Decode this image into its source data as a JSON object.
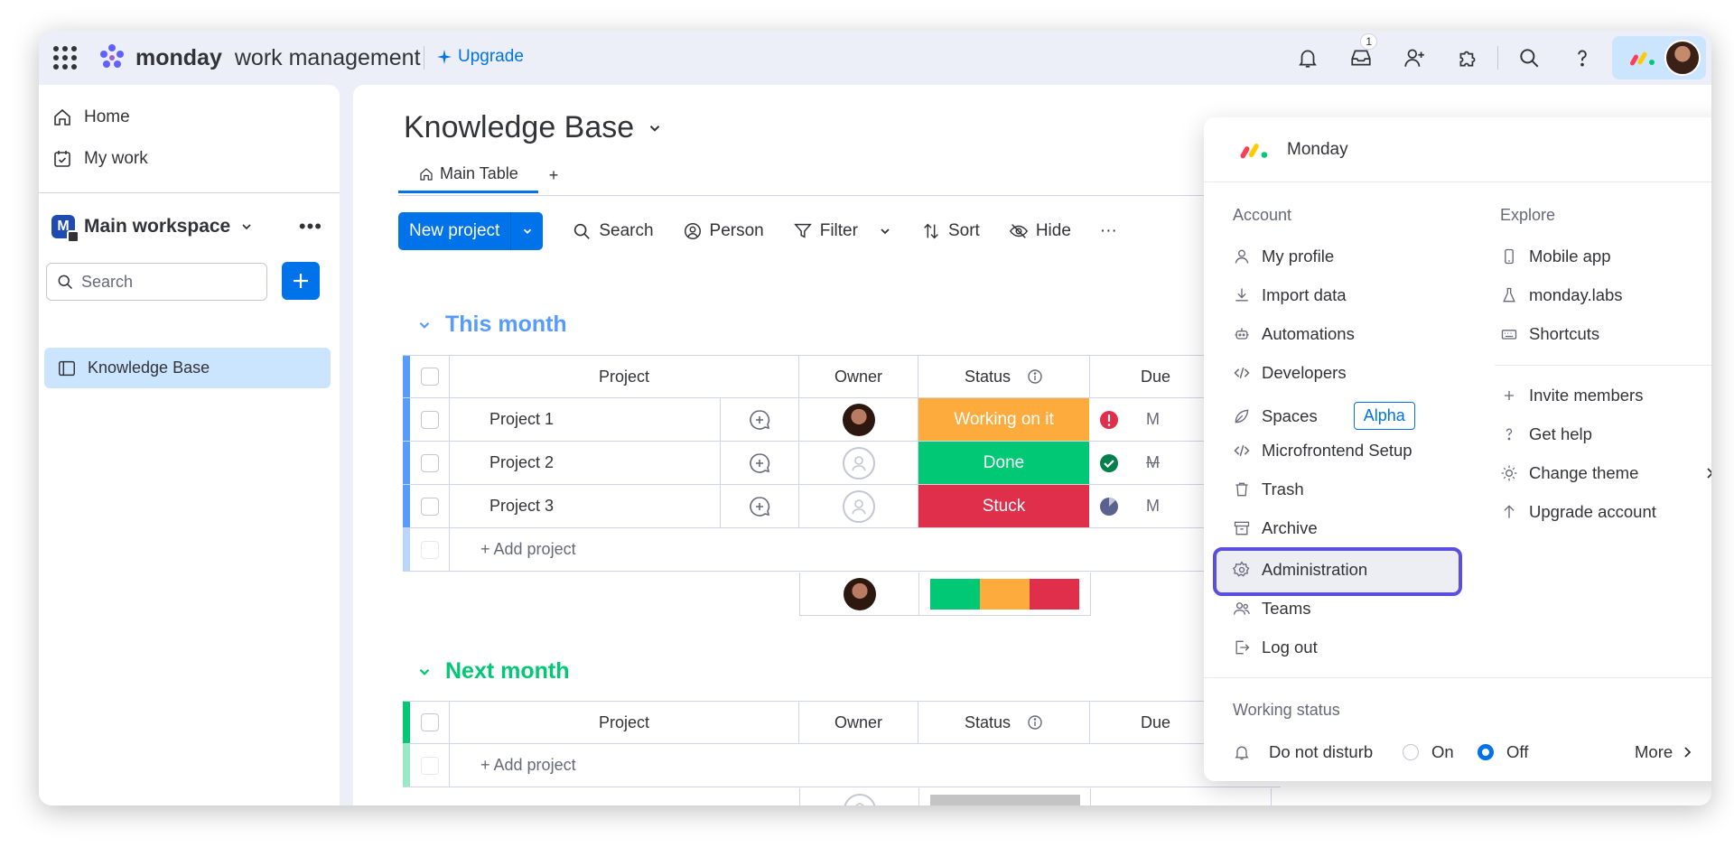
{
  "topbar": {
    "brand_bold": "monday",
    "brand_rest": "work management",
    "upgrade_label": "Upgrade",
    "inbox_count": "1"
  },
  "sidebar": {
    "home": "Home",
    "my_work": "My work",
    "workspace_initial": "M",
    "workspace_name": "Main workspace",
    "search_placeholder": "Search",
    "board": "Knowledge Base"
  },
  "board": {
    "title": "Knowledge Base",
    "tab_main": "Main Table",
    "tab_add": "+",
    "toolbar": {
      "new_project": "New project",
      "search": "Search",
      "person": "Person",
      "filter": "Filter",
      "sort": "Sort",
      "hide": "Hide",
      "more": "···"
    },
    "columns": {
      "project": "Project",
      "owner": "Owner",
      "status": "Status",
      "due": "Due"
    },
    "groups": [
      {
        "name": "This month",
        "color": "#579bfc",
        "rows": [
          {
            "name": "Project 1",
            "status": "Working on it",
            "status_color": "#fdab3d",
            "due": "M"
          },
          {
            "name": "Project 2",
            "status": "Done",
            "status_color": "#00c875",
            "due": "M"
          },
          {
            "name": "Project 3",
            "status": "Stuck",
            "status_color": "#df2f4a",
            "due": "M"
          }
        ],
        "add_label": "+ Add project"
      },
      {
        "name": "Next month",
        "color": "#00c875",
        "add_label": "+ Add project"
      }
    ]
  },
  "menu": {
    "account_name": "Monday",
    "account_title": "Account",
    "explore_title": "Explore",
    "account_items": [
      "My profile",
      "Import data",
      "Automations",
      "Developers",
      "Spaces",
      "Microfrontend Setup",
      "Trash",
      "Archive",
      "Administration",
      "Teams",
      "Log out"
    ],
    "alpha_tag": "Alpha",
    "explore_items": [
      "Mobile app",
      "monday.labs",
      "Shortcuts"
    ],
    "explore_items2": [
      "Invite members",
      "Get help",
      "Change theme",
      "Upgrade account"
    ],
    "working_status_title": "Working status",
    "dnd_label": "Do not disturb",
    "on_label": "On",
    "off_label": "Off",
    "more_label": "More"
  }
}
